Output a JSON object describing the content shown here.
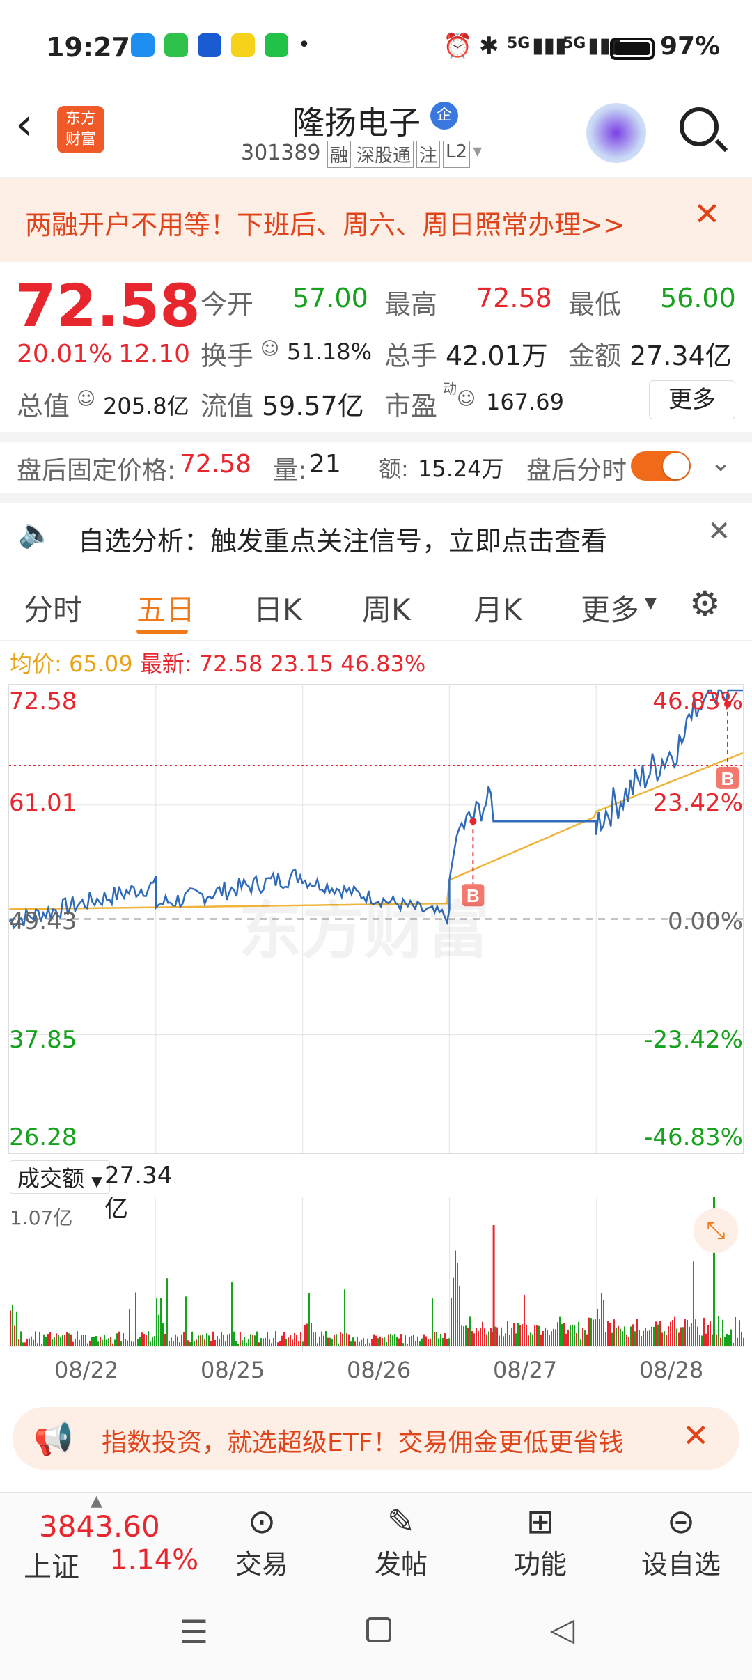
{
  "status": {
    "time": "19:27",
    "battery": "97%",
    "signal1": "5G",
    "signal2": "5G"
  },
  "header": {
    "title": "隆扬电子",
    "badge": "企",
    "code": "301389",
    "tags": [
      "融",
      "深股通",
      "注",
      "L2"
    ]
  },
  "banner": {
    "text": "两融开户不用等！下班后、周六、周日照常办理>>"
  },
  "quote": {
    "price": "72.58",
    "pct": "20.01%",
    "chg": "12.10",
    "open_label": "今开",
    "open": "57.00",
    "high_label": "最高",
    "high": "72.58",
    "low_label": "最低",
    "low": "56.00",
    "turn_label": "换手",
    "turn": "51.18%",
    "vol_label": "总手",
    "vol": "42.01万",
    "amt_label": "金额",
    "amt": "27.34亿",
    "mcap_label": "总值",
    "mcap": "205.8亿",
    "fmcap_label": "流值",
    "fmcap": "59.57亿",
    "pe_label": "市盈",
    "pe_sup": "动",
    "pe": "167.69",
    "more": "更多"
  },
  "after": {
    "price_label": "盘后固定价格:",
    "price": "72.58",
    "vol_label": "量:",
    "vol": "21",
    "amt_label": "额:",
    "amt": "15.24万",
    "toggle_label": "盘后分时"
  },
  "notice": {
    "text": "自选分析：触发重点关注信号，立即点击查看"
  },
  "tabs": [
    "分时",
    "五日",
    "日K",
    "周K",
    "月K",
    "更多"
  ],
  "active_tab": "五日",
  "legend": {
    "avg_label": "均价:",
    "avg": "65.09",
    "latest_label": "最新:",
    "latest": "72.58",
    "chg": "23.15",
    "pct": "46.83%"
  },
  "chart_data": {
    "type": "line",
    "y_left": [
      "72.58",
      "61.01",
      "49.43",
      "37.85",
      "26.28"
    ],
    "y_right": [
      "46.83%",
      "23.42%",
      "0.00%",
      "-23.42%",
      "-46.83%"
    ],
    "x_dates": [
      "08/22",
      "08/25",
      "08/26",
      "08/27",
      "08/28"
    ],
    "watermark": "东方财富",
    "marker": "B",
    "vol_select": "成交额",
    "vol_total": "27.34亿",
    "vol_max": "1.07亿",
    "colors": {
      "price": "#2f6bb8",
      "avg": "#f0b43a",
      "up": "#e8262d",
      "down": "#16a21d"
    }
  },
  "promo": {
    "text": "指数投资，就选超级ETF！交易佣金更低更省钱"
  },
  "bottom": {
    "index_value": "3843.60",
    "index_name": "上证",
    "index_pct": "1.14%",
    "items": [
      "交易",
      "发帖",
      "功能",
      "设自选"
    ]
  }
}
